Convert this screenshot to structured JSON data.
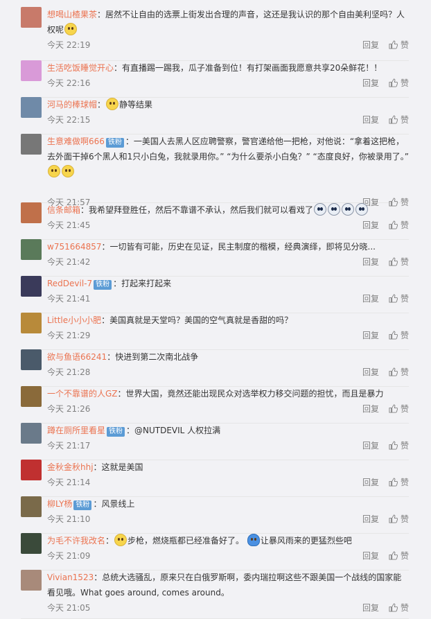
{
  "reply_label": "回复",
  "like_label": "赞",
  "comments": [
    {
      "user": "想喝山楂果茶",
      "badge": "",
      "text": "：居然不让自由的选票上街发出合理的声音，这还是我认识的那个自由美利坚吗？人权呢",
      "emoji": "think",
      "time": "今天 22:19",
      "avatar_color": "#c87a6a"
    },
    {
      "user": "生活吃饭睡觉开心",
      "badge": "",
      "text": "：有直播踢一踢我，瓜子准备到位！有打架画面我愿意共享20朵鲜花！！",
      "emoji": "",
      "time": "今天 22:16",
      "avatar_color": "#d99ad8"
    },
    {
      "user": "河马的棒球帽",
      "badge": "",
      "text": "静等结果",
      "emoji": "lead",
      "time": "今天 22:15",
      "avatar_color": "#6f8aa8"
    },
    {
      "user": "生意难做啊666",
      "badge": "铁粉",
      "text": "：一美国人去黑人区应聘警察，警官递给他一把枪，对他说：“拿着这把枪，去外面干掉6个黑人和1只小白兔，我就录用你。” “为什么要杀小白兔？” “态度良好，你被录用了。”",
      "emoji": "two",
      "time": "今天 21:57",
      "avatar_color": "#777777"
    },
    {
      "user": "信条邮箱",
      "badge": "",
      "text": "：我希望拜登胜任，然后不靠谱不承认，然后我们就可以看戏了",
      "emoji": "cry4",
      "time": "今天 21:45",
      "avatar_color": "#c0704a"
    },
    {
      "user": "w751664857",
      "badge": "",
      "text": "：一切皆有可能，历史在见证，民主制度的楷模，经典演绎，即将见分晓...",
      "emoji": "",
      "time": "今天 21:42",
      "avatar_color": "#5a7a5a"
    },
    {
      "user": "RedDevil-7",
      "badge": "铁粉",
      "text": "：打起来打起来",
      "emoji": "",
      "time": "今天 21:41",
      "avatar_color": "#3a3a5a"
    },
    {
      "user": "Little小小小肥",
      "badge": "",
      "text": "：美国真就是天堂吗？美国的空气真就是香甜的吗？",
      "emoji": "",
      "time": "今天 21:29",
      "avatar_color": "#b88a3a"
    },
    {
      "user": "欲与鱼语66241",
      "badge": "",
      "text": "：快进到第二次南北战争",
      "emoji": "",
      "time": "今天 21:28",
      "avatar_color": "#4a5a6a"
    },
    {
      "user": "一个不靠谱的人GZ",
      "badge": "",
      "text": "：世界大国，竟然还能出现民众对选举权力移交问题的担忧，而且是暴力",
      "emoji": "",
      "time": "今天 21:26",
      "avatar_color": "#8a6a3a"
    },
    {
      "user": "蹲在厕所里看星",
      "badge": "铁粉",
      "text": "：@NUTDEVIL 人权拉满",
      "emoji": "",
      "time": "今天 21:17",
      "avatar_color": "#6a7a8a"
    },
    {
      "user": "金秋金秋hhj",
      "badge": "",
      "text": "：这就是美国",
      "emoji": "",
      "time": "今天 21:14",
      "avatar_color": "#c03030"
    },
    {
      "user": "柳LY杨",
      "badge": "铁粉",
      "text": "：风景线上",
      "emoji": "",
      "time": "今天 21:10",
      "avatar_color": "#7a6a4a"
    },
    {
      "user": "为毛不许我改名",
      "badge": "",
      "text": "步枪，燃烧瓶都已经准备好了。",
      "text2": "让暴风雨来的更猛烈些吧",
      "emoji": "mix",
      "time": "今天 21:09",
      "avatar_color": "#3a4a3a"
    },
    {
      "user": "Vivian1523",
      "badge": "",
      "text": "：总统大选骚乱，原来只在白俄罗斯啊，委内瑞拉啊这些不跟美国一个战线的国家能看见哦。What goes around, comes around。",
      "emoji": "",
      "time": "今天 21:05",
      "avatar_color": "#a88a7a"
    }
  ]
}
